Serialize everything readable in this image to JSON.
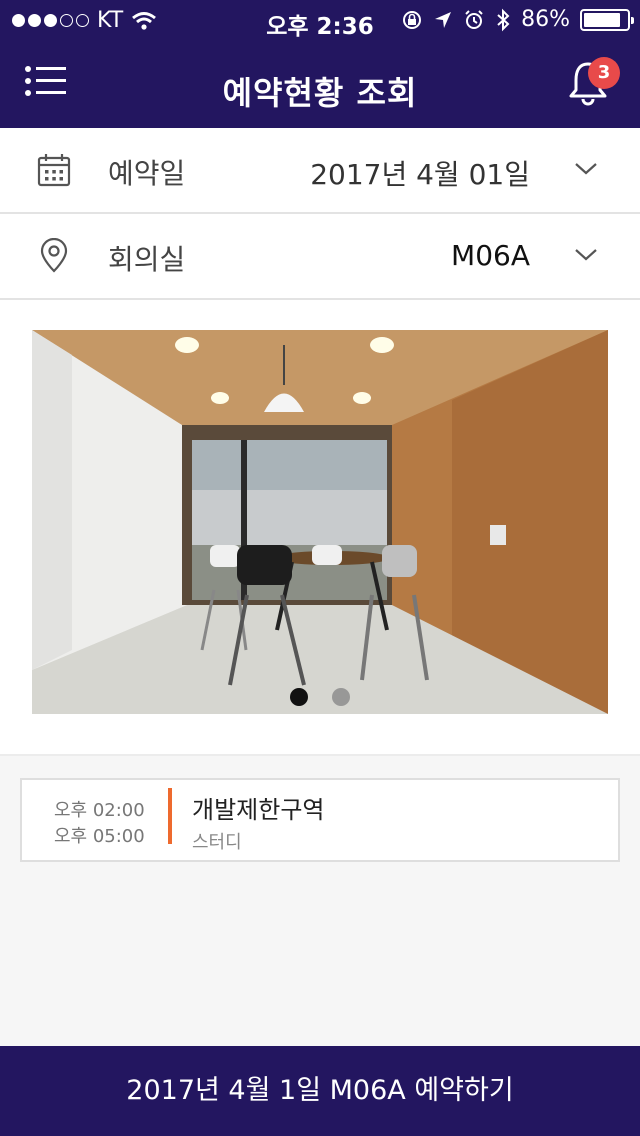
{
  "status_bar": {
    "carrier": "KT",
    "time": "오후 2:36",
    "battery": "86%",
    "battery_level": 0.86,
    "signal_dots_filled": 3,
    "signal_dots_total": 5
  },
  "header": {
    "title": "예약현황 조회",
    "notification_count": "3",
    "menu_icon": "list-menu-icon",
    "bell_icon": "bell-icon"
  },
  "filters": {
    "date": {
      "label": "예약일",
      "value": "2017년 4월 01일",
      "icon": "calendar-icon"
    },
    "room": {
      "label": "회의실",
      "value": "M06A",
      "icon": "location-pin-icon"
    }
  },
  "gallery": {
    "image": "meeting-room-photo",
    "pages": 2,
    "active_page": 1
  },
  "reservations": [
    {
      "start": "오후 02:00",
      "end": "오후 05:00",
      "title": "개발제한구역",
      "type": "스터디"
    }
  ],
  "cta": {
    "label": "2017년 4월 1일 M06A 예약하기"
  },
  "colors": {
    "brand": "#231660",
    "accent": "#ee6a2e",
    "badge": "#e84a4a"
  }
}
